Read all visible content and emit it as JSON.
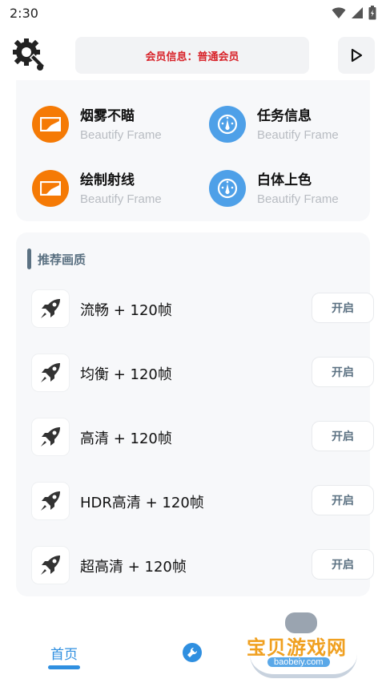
{
  "status_bar": {
    "time": "2:30"
  },
  "header": {
    "member_info": "会员信息：普通会员"
  },
  "features": [
    {
      "title": "烟雾不瞄",
      "subtitle": "Beautify Frame",
      "color": "#f57a05",
      "icon": "frame-icon"
    },
    {
      "title": "任务信息",
      "subtitle": "Beautify Frame",
      "color": "#4ea0e8",
      "icon": "gauge-icon"
    },
    {
      "title": "绘制射线",
      "subtitle": "Beautify Frame",
      "color": "#f57a05",
      "icon": "frame-icon"
    },
    {
      "title": "白体上色",
      "subtitle": "Beautify Frame",
      "color": "#4ea0e8",
      "icon": "gauge-icon"
    }
  ],
  "quality": {
    "section_title": "推荐画质",
    "items": [
      {
        "label": "流畅 + 120帧",
        "button": "开启"
      },
      {
        "label": "均衡 + 120帧",
        "button": "开启"
      },
      {
        "label": "高清 + 120帧",
        "button": "开启"
      },
      {
        "label": "HDR高清 + 120帧",
        "button": "开启"
      },
      {
        "label": "超高清 + 120帧",
        "button": "开启"
      }
    ]
  },
  "bottom_nav": {
    "home_label": "首页",
    "active_color": "#2f8fe0"
  },
  "watermark": {
    "text": "宝贝游戏网",
    "url": "baobeiy.com"
  }
}
